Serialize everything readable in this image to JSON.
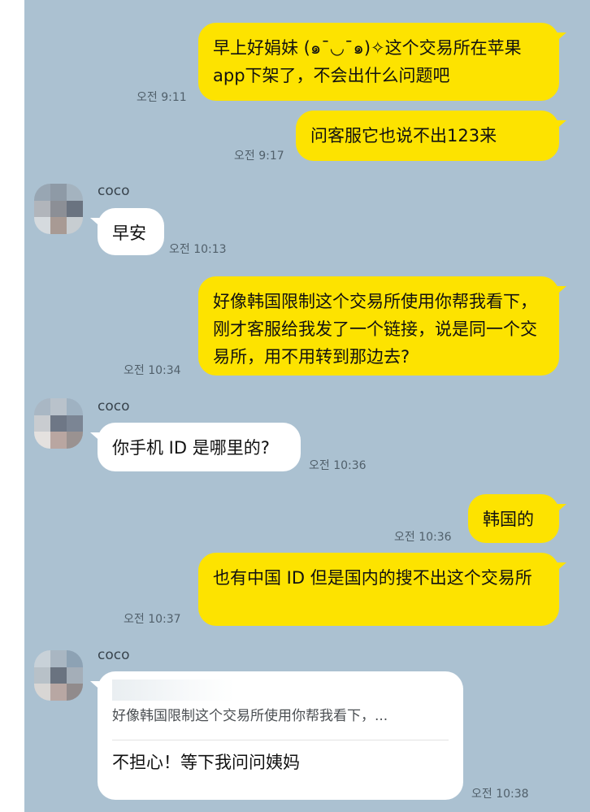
{
  "chat": {
    "messages": [
      {
        "type": "out",
        "text": "早上好娟妹 (๑¯◡¯๑)✧这个交易所在苹果app下架了，不会出什么问题吧",
        "time": "오전 9:11"
      },
      {
        "type": "out",
        "text": "问客服它也说不出123来",
        "time": "오전 9:17"
      },
      {
        "type": "in",
        "sender": "coco",
        "text": "早安",
        "time": "오전 10:13"
      },
      {
        "type": "out",
        "text": "好像韩国限制这个交易所使用你帮我看下，刚才客服给我发了一个链接，说是同一个交易所，用不用转到那边去?",
        "time": "오전 10:34"
      },
      {
        "type": "in",
        "sender": "coco",
        "text": "你手机 ID 是哪里的?",
        "time": "오전 10:36"
      },
      {
        "type": "out",
        "text": "韩国的",
        "time": "오전 10:36"
      },
      {
        "type": "out",
        "text": "也有中国 ID 但是国内的搜不出这个交易所",
        "time": "오전 10:37"
      },
      {
        "type": "in",
        "sender": "coco",
        "quote": "好像韩国限制这个交易所使用你帮我看下，...",
        "text": "不担心！等下我问问姨妈",
        "time": "오전 10:38"
      }
    ]
  },
  "colors": {
    "background": "#abc1d1",
    "outgoing_bubble": "#fde300",
    "incoming_bubble": "#ffffff"
  }
}
